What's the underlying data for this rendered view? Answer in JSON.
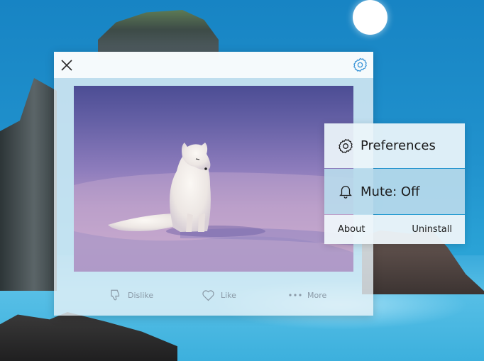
{
  "background": {
    "moon_color": "#ffffff",
    "sea_color": "#3aaadb"
  },
  "photo_window": {
    "close_icon": "close-icon",
    "settings_icon": "gear-icon",
    "image_subject": "arctic-fox-on-snow",
    "actions": {
      "dislike_label": "Dislike",
      "like_label": "Like",
      "more_label": "More"
    }
  },
  "context_menu": {
    "preferences_label": "Preferences",
    "mute_label": "Mute: Off",
    "about_label": "About",
    "uninstall_label": "Uninstall",
    "highlight_color": "#b8daec"
  }
}
